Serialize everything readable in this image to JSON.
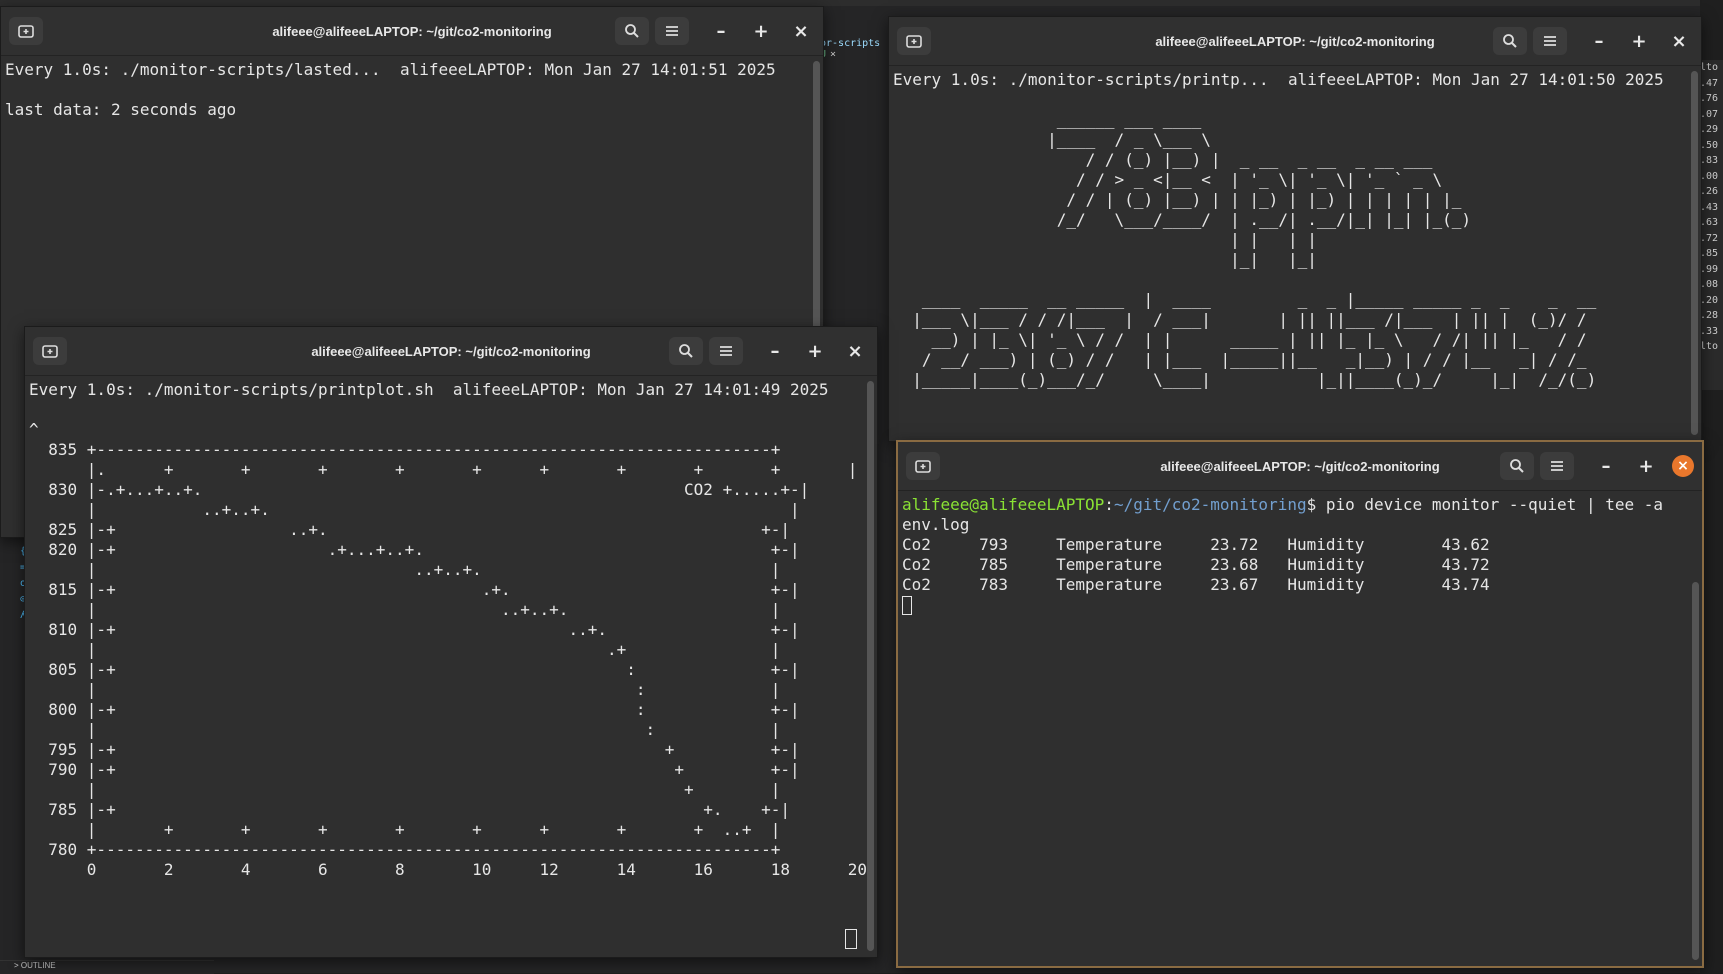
{
  "background": {
    "tab_text": "or-scripts",
    "tab_badge": "U",
    "tab_close": "×",
    "outline_label": "> OUTLINE",
    "side_glyphs": [
      "3",
      "{",
      "=",
      "o",
      "⊙",
      "ʎ"
    ],
    "right_edge_numbers": [
      "lto",
      ".47",
      ".76",
      ".07",
      ".29",
      ".50",
      ".83",
      ".00",
      ".26",
      ".43",
      ".63",
      ".72",
      ".85",
      ".99",
      ".08",
      ".20",
      ".28",
      ".33",
      "lto"
    ]
  },
  "windows": {
    "lastdata": {
      "title": "alifeee@alifeeeLAPTOP: ~/git/co2-monitoring",
      "header_line": "Every 1.0s: ./monitor-scripts/lasted...  alifeeeLAPTOP: Mon Jan 27 14:01:51 2025",
      "body_line": "last data: 2 seconds ago"
    },
    "banner": {
      "title": "alifeee@alifeeeLAPTOP: ~/git/co2-monitoring",
      "header_line": "Every 1.0s: ./monitor-scripts/printp...  alifeeeLAPTOP: Mon Jan 27 14:01:50 2025",
      "ascii_lines": [
        "                 ______ ___ ____",
        "                |____  / _ \\___ \\",
        "                    / / (_) |__) |  _ __  _ __  _ __ ___",
        "                   / / > _ <|__ <  | '_ \\| '_ \\| '_ ` _ \\",
        "                  / / | (_) |__) | | |_) | |_) | | | | | |_",
        "                 /_/   \\___/____/  | .__/| .__/|_| |_| |_(_)",
        "                                   | |   | |",
        "                                   |_|   |_|",
        "",
        "   ____  _____  __ _____  |  ____         _  _ |_____ _____ _  _    _  __",
        "  |___ \\|___ / / /|___  |  / ___|       | || ||___ /|___  | || |  (_)/ /",
        "    __) | |_ \\| '_ \\ / /  | |      _____ | || |_ |_ \\   / /| || |_   / /",
        "   / __/ ___) | (_) / /   | |___  |_____||__   _|__) | / / |__   _| / /_",
        "  |_____|____(_)___/_/     \\____|           |_||____(_)_/     |_|  /_/(_)"
      ]
    },
    "plot": {
      "title": "alifeee@alifeeeLAPTOP: ~/git/co2-monitoring",
      "header_line": "Every 1.0s: ./monitor-scripts/printplot.sh  alifeeeLAPTOP: Mon Jan 27 14:01:49 2025",
      "plot_lines": [
        "",
        "^",
        "  835 +----------------------------------------------------------------------+",
        "      |.      +       +       +       +       +      +       +       +       +       |",
        "  830 |-.+...+..+.                                                  CO2 +.....+-|",
        "      |           ..+..+.                                                      |",
        "  825 |-+                  ..+.                                             +-|",
        "  820 |-+                      .+...+..+.                                    +-|",
        "      |                                 ..+..+.                              |",
        "  815 |-+                                      .+.                           +-|",
        "      |                                          ..+..+.                     |",
        "  810 |-+                                               ..+.                 +-|",
        "      |                                                     .+               |",
        "  805 |-+                                                     :              +-|",
        "      |                                                        :             |",
        "  800 |-+                                                      :             +-|",
        "      |                                                         :            |",
        "  795 |-+                                                         +          +-|",
        "  790 |-+                                                          +         +-|",
        "      |                                                             +        |",
        "  785 |-+                                                             +.    +-|",
        "      |       +       +       +       +       +      +       +       +  ..+  |",
        "  780 +----------------------------------------------------------------------+",
        "      0       2       4       6       8       10     12      14      16      18      20"
      ]
    },
    "monitor": {
      "title": "alifeee@alifeeeLAPTOP: ~/git/co2-monitoring",
      "prompt_user": "alifeee@alifeeeLAPTOP",
      "prompt_sep": ":",
      "prompt_path": "~/git/co2-monitoring",
      "prompt_cmd": "$ pio device monitor --quiet | tee -a",
      "prompt_cmd_wrap": "env.log",
      "rows": [
        "Co2     793     Temperature     23.72   Humidity        43.62",
        "Co2     785     Temperature     23.68   Humidity        43.72",
        "Co2     783     Temperature     23.67   Humidity        43.74"
      ]
    }
  },
  "icons": {
    "new_tab": "new-tab-icon",
    "search": "search-icon",
    "menu": "hamburger-menu-icon",
    "minimize": "minimize-icon",
    "maximize": "maximize-icon",
    "close": "close-icon"
  },
  "window_buttons": {
    "minimize": "–",
    "maximize": "+",
    "close": "×"
  },
  "colors": {
    "prompt_user": "#8ae234",
    "prompt_path": "#729fcf",
    "focus_border": "#8a6b42",
    "close_accent": "#e9772c"
  }
}
